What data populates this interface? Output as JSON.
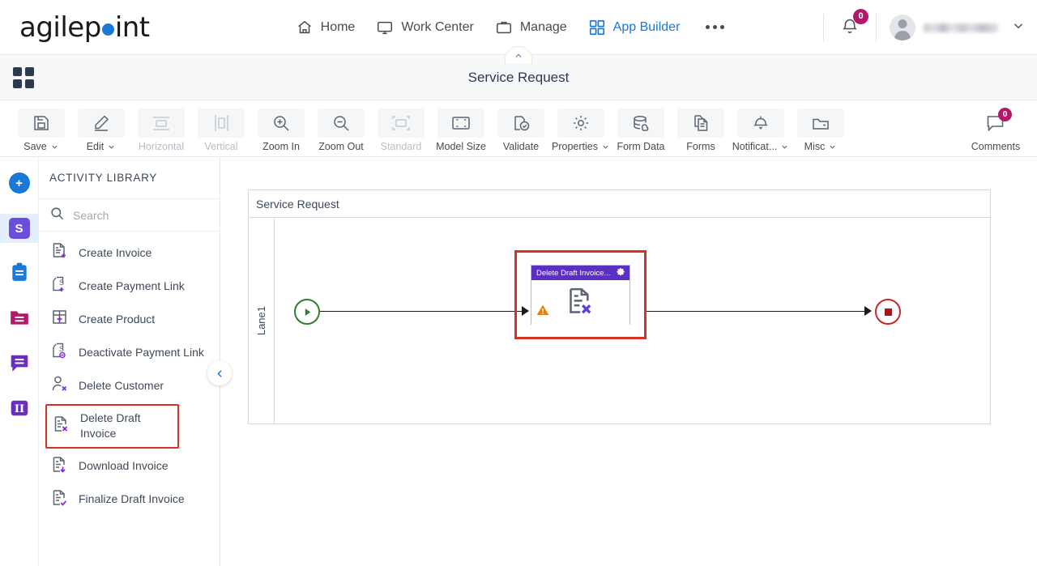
{
  "header": {
    "logo_text_1": "agilep",
    "logo_text_2": "int",
    "nav": [
      {
        "label": "Home",
        "icon": "home-icon",
        "active": false
      },
      {
        "label": "Work Center",
        "icon": "monitor-icon",
        "active": false
      },
      {
        "label": "Manage",
        "icon": "briefcase-icon",
        "active": false
      },
      {
        "label": "App Builder",
        "icon": "grid-icon",
        "active": true
      }
    ],
    "more_label": "more-options",
    "notification_count": "0",
    "username": ""
  },
  "titlebar": {
    "title": "Service Request"
  },
  "toolbar": {
    "buttons": [
      {
        "label": "Save",
        "icon": "save-icon",
        "caret": true,
        "disabled": false
      },
      {
        "label": "Edit",
        "icon": "pencil-icon",
        "caret": true,
        "disabled": false
      },
      {
        "label": "Horizontal",
        "icon": "horizontal-layout-icon",
        "caret": false,
        "disabled": true
      },
      {
        "label": "Vertical",
        "icon": "vertical-layout-icon",
        "caret": false,
        "disabled": true
      },
      {
        "label": "Zoom In",
        "icon": "zoom-in-icon",
        "caret": false,
        "disabled": false
      },
      {
        "label": "Zoom Out",
        "icon": "zoom-out-icon",
        "caret": false,
        "disabled": false
      },
      {
        "label": "Standard",
        "icon": "standard-size-icon",
        "caret": false,
        "disabled": true
      },
      {
        "label": "Model Size",
        "icon": "model-size-icon",
        "caret": false,
        "disabled": false
      },
      {
        "label": "Validate",
        "icon": "validate-icon",
        "caret": false,
        "disabled": false
      },
      {
        "label": "Properties",
        "icon": "gear-icon",
        "caret": true,
        "disabled": false
      },
      {
        "label": "Form Data",
        "icon": "database-icon",
        "caret": false,
        "disabled": false
      },
      {
        "label": "Forms",
        "icon": "forms-icon",
        "caret": false,
        "disabled": false
      },
      {
        "label": "Notificat...",
        "icon": "bell-icon",
        "caret": true,
        "disabled": false
      },
      {
        "label": "Misc",
        "icon": "folder-icon",
        "caret": true,
        "disabled": false
      }
    ],
    "comments": {
      "label": "Comments",
      "icon": "comment-icon",
      "count": "0"
    }
  },
  "rail": {
    "items": [
      {
        "name": "add-button",
        "glyph": "+",
        "color": "#1a78d6",
        "shape": "circle",
        "selected": false
      },
      {
        "name": "stripe-app",
        "glyph": "S",
        "color": "#6b4fdb",
        "shape": "rounded",
        "selected": true
      },
      {
        "name": "clipboard-app",
        "glyph": "",
        "color": "#1a78d6",
        "shape": "clipboard",
        "selected": false
      },
      {
        "name": "folder-app",
        "glyph": "",
        "color": "#b5176b",
        "shape": "folder",
        "selected": false
      },
      {
        "name": "chat-app",
        "glyph": "",
        "color": "#6b2fbf",
        "shape": "chat",
        "selected": false
      },
      {
        "name": "pillars-app",
        "glyph": "II",
        "color": "#6b2fbf",
        "shape": "rounded-outline",
        "selected": false
      }
    ]
  },
  "panel": {
    "title": "ACTIVITY LIBRARY",
    "search": {
      "placeholder": "Search",
      "value": ""
    },
    "activities": [
      {
        "label": "Create Invoice",
        "icon": "doc-plus-icon",
        "highlighted": false
      },
      {
        "label": "Create Payment Link",
        "icon": "payment-link-plus-icon",
        "highlighted": false
      },
      {
        "label": "Create Product",
        "icon": "box-plus-icon",
        "highlighted": false
      },
      {
        "label": "Deactivate Payment Link",
        "icon": "payment-link-minus-icon",
        "highlighted": false
      },
      {
        "label": "Delete Customer",
        "icon": "person-x-icon",
        "highlighted": false
      },
      {
        "label": "Delete Draft Invoice",
        "icon": "doc-x-icon",
        "highlighted": true
      },
      {
        "label": "Download Invoice",
        "icon": "doc-download-icon",
        "highlighted": false
      },
      {
        "label": "Finalize Draft Invoice",
        "icon": "doc-check-icon",
        "highlighted": false
      }
    ],
    "collapse_label": "collapse-panel"
  },
  "canvas": {
    "pool_title": "Service Request",
    "lane_label": "Lane1",
    "task": {
      "title": "Delete Draft Invoice...",
      "icon": "doc-x-icon",
      "has_warning": true,
      "selected": true,
      "settings_icon": "gear-icon"
    },
    "start_node": "start-event",
    "end_node": "end-event"
  },
  "colors": {
    "accent_blue": "#1a78d6",
    "badge_magenta": "#b5176b",
    "task_purple": "#5b2fbf",
    "selection_red": "#d93025",
    "start_green": "#2e7d32",
    "end_red": "#c62828",
    "warning_orange": "#e8820c"
  }
}
